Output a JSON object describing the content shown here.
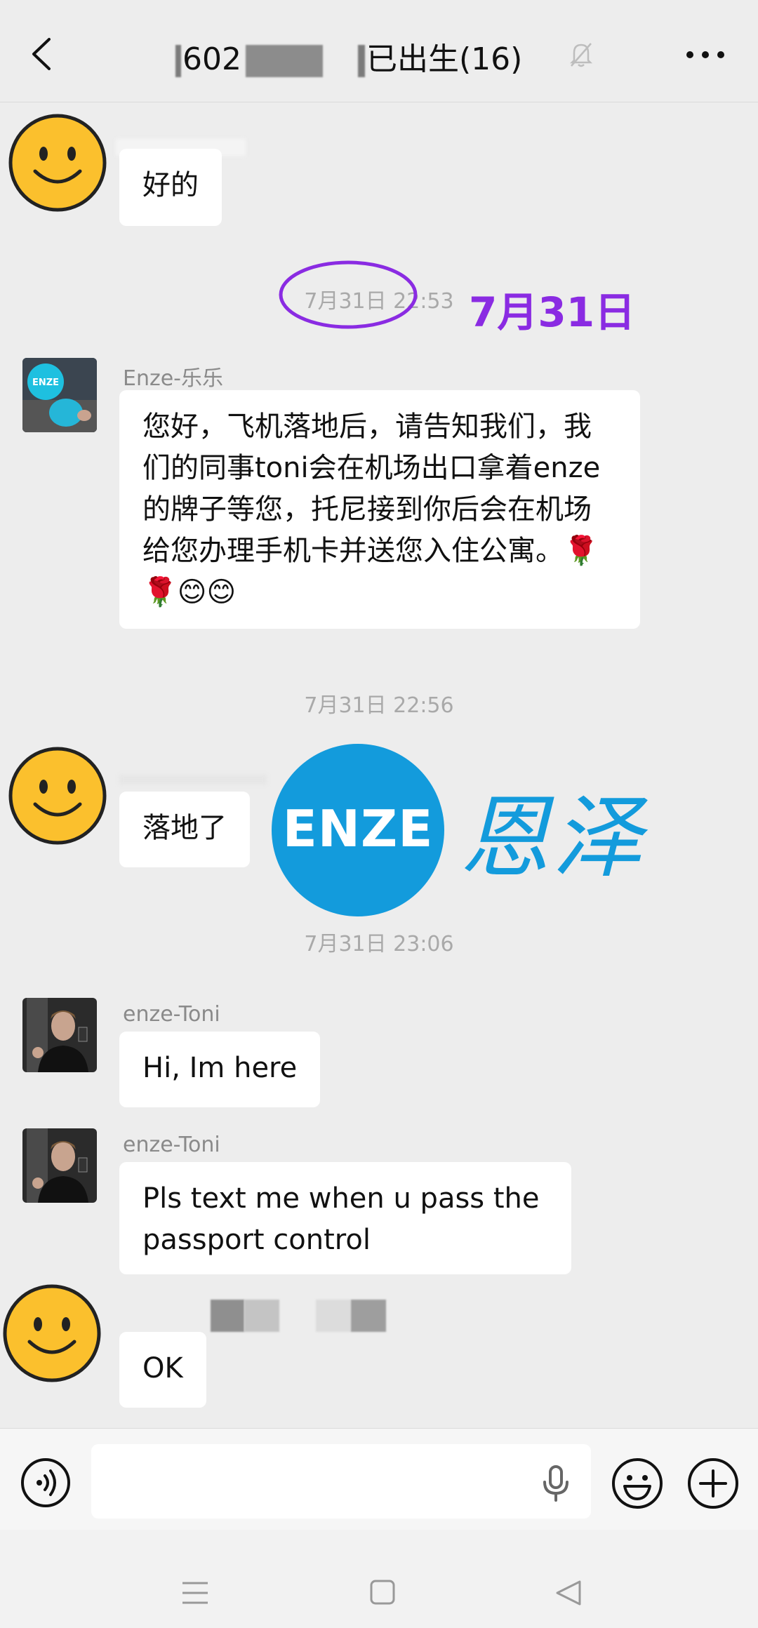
{
  "header": {
    "title_prefix": "602",
    "title_suffix": "已出生(16)"
  },
  "messages": [
    {
      "text": "好的"
    },
    {
      "timestamp": "7月31日 22:53",
      "annotation": "7月31日"
    },
    {
      "sender": "Enze-乐乐",
      "text": "您好，飞机落地后，请告知我们，我们的同事toni会在机场出口拿着enze的牌子等您，托尼接到你后会在机场给您办理手机卡并送您入住公寓。🌹🌹😊😊"
    },
    {
      "timestamp": "7月31日 22:56"
    },
    {
      "text": "落地了"
    },
    {
      "timestamp": "7月31日 23:06"
    },
    {
      "sender": "enze-Toni",
      "text": "Hi, Im here"
    },
    {
      "sender": "enze-Toni",
      "text": "Pls text me when u pass the passport control"
    },
    {
      "text": "OK"
    }
  ],
  "watermark": {
    "logo_text": "ENZE",
    "chinese": "恩泽"
  },
  "avatar_badge": "ENZE",
  "colors": {
    "annotation": "#8a2be2",
    "enze_blue": "#139bdc",
    "smiley": "#fbc02d"
  }
}
